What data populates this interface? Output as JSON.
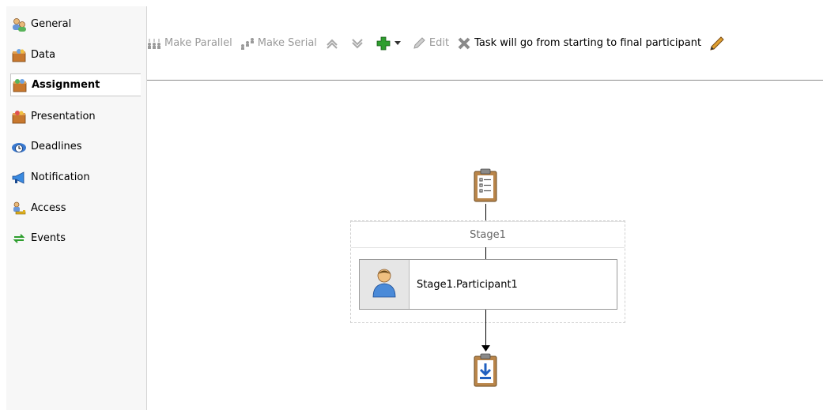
{
  "sidebar": {
    "items": [
      {
        "label": "General",
        "icon": "people-icon"
      },
      {
        "label": "Data",
        "icon": "data-box-icon"
      },
      {
        "label": "Assignment",
        "icon": "assignment-box-icon",
        "active": true
      },
      {
        "label": "Presentation",
        "icon": "presentation-box-icon"
      },
      {
        "label": "Deadlines",
        "icon": "clock-eye-icon"
      },
      {
        "label": "Notification",
        "icon": "megaphone-icon"
      },
      {
        "label": "Access",
        "icon": "key-person-icon"
      },
      {
        "label": "Events",
        "icon": "arrows-cycle-icon"
      }
    ]
  },
  "toolbar": {
    "make_parallel": "Make Parallel",
    "make_serial": "Make Serial",
    "edit": "Edit",
    "routing_text": "Task will go from starting to final participant"
  },
  "diagram": {
    "stage_label": "Stage1",
    "participant_label": "Stage1.Participant1"
  },
  "colors": {
    "accent_green": "#2e9e2e",
    "clipboard": "#b9854a",
    "download_blue": "#1f5fbf"
  }
}
